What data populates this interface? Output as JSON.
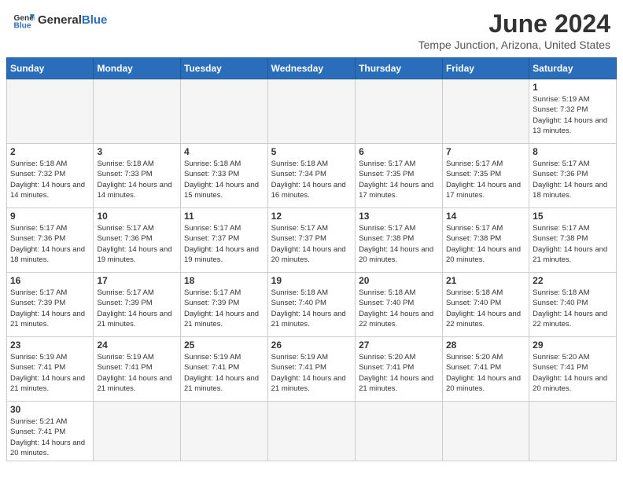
{
  "header": {
    "logo_general": "General",
    "logo_blue": "Blue",
    "month_title": "June 2024",
    "location": "Tempe Junction, Arizona, United States"
  },
  "days_of_week": [
    "Sunday",
    "Monday",
    "Tuesday",
    "Wednesday",
    "Thursday",
    "Friday",
    "Saturday"
  ],
  "weeks": [
    [
      {
        "day": "",
        "empty": true
      },
      {
        "day": "",
        "empty": true
      },
      {
        "day": "",
        "empty": true
      },
      {
        "day": "",
        "empty": true
      },
      {
        "day": "",
        "empty": true
      },
      {
        "day": "",
        "empty": true
      },
      {
        "day": "1",
        "sunrise": "5:19 AM",
        "sunset": "7:32 PM",
        "daylight": "14 hours and 13 minutes."
      }
    ],
    [
      {
        "day": "2",
        "sunrise": "5:18 AM",
        "sunset": "7:32 PM",
        "daylight": "14 hours and 14 minutes."
      },
      {
        "day": "3",
        "sunrise": "5:18 AM",
        "sunset": "7:33 PM",
        "daylight": "14 hours and 14 minutes."
      },
      {
        "day": "4",
        "sunrise": "5:18 AM",
        "sunset": "7:33 PM",
        "daylight": "14 hours and 15 minutes."
      },
      {
        "day": "5",
        "sunrise": "5:18 AM",
        "sunset": "7:34 PM",
        "daylight": "14 hours and 16 minutes."
      },
      {
        "day": "6",
        "sunrise": "5:17 AM",
        "sunset": "7:35 PM",
        "daylight": "14 hours and 17 minutes."
      },
      {
        "day": "7",
        "sunrise": "5:17 AM",
        "sunset": "7:35 PM",
        "daylight": "14 hours and 17 minutes."
      },
      {
        "day": "8",
        "sunrise": "5:17 AM",
        "sunset": "7:36 PM",
        "daylight": "14 hours and 18 minutes."
      }
    ],
    [
      {
        "day": "9",
        "sunrise": "5:17 AM",
        "sunset": "7:36 PM",
        "daylight": "14 hours and 18 minutes."
      },
      {
        "day": "10",
        "sunrise": "5:17 AM",
        "sunset": "7:36 PM",
        "daylight": "14 hours and 19 minutes."
      },
      {
        "day": "11",
        "sunrise": "5:17 AM",
        "sunset": "7:37 PM",
        "daylight": "14 hours and 19 minutes."
      },
      {
        "day": "12",
        "sunrise": "5:17 AM",
        "sunset": "7:37 PM",
        "daylight": "14 hours and 20 minutes."
      },
      {
        "day": "13",
        "sunrise": "5:17 AM",
        "sunset": "7:38 PM",
        "daylight": "14 hours and 20 minutes."
      },
      {
        "day": "14",
        "sunrise": "5:17 AM",
        "sunset": "7:38 PM",
        "daylight": "14 hours and 20 minutes."
      },
      {
        "day": "15",
        "sunrise": "5:17 AM",
        "sunset": "7:38 PM",
        "daylight": "14 hours and 21 minutes."
      }
    ],
    [
      {
        "day": "16",
        "sunrise": "5:17 AM",
        "sunset": "7:39 PM",
        "daylight": "14 hours and 21 minutes."
      },
      {
        "day": "17",
        "sunrise": "5:17 AM",
        "sunset": "7:39 PM",
        "daylight": "14 hours and 21 minutes."
      },
      {
        "day": "18",
        "sunrise": "5:17 AM",
        "sunset": "7:39 PM",
        "daylight": "14 hours and 21 minutes."
      },
      {
        "day": "19",
        "sunrise": "5:18 AM",
        "sunset": "7:40 PM",
        "daylight": "14 hours and 21 minutes."
      },
      {
        "day": "20",
        "sunrise": "5:18 AM",
        "sunset": "7:40 PM",
        "daylight": "14 hours and 22 minutes."
      },
      {
        "day": "21",
        "sunrise": "5:18 AM",
        "sunset": "7:40 PM",
        "daylight": "14 hours and 22 minutes."
      },
      {
        "day": "22",
        "sunrise": "5:18 AM",
        "sunset": "7:40 PM",
        "daylight": "14 hours and 22 minutes."
      }
    ],
    [
      {
        "day": "23",
        "sunrise": "5:19 AM",
        "sunset": "7:41 PM",
        "daylight": "14 hours and 21 minutes."
      },
      {
        "day": "24",
        "sunrise": "5:19 AM",
        "sunset": "7:41 PM",
        "daylight": "14 hours and 21 minutes."
      },
      {
        "day": "25",
        "sunrise": "5:19 AM",
        "sunset": "7:41 PM",
        "daylight": "14 hours and 21 minutes."
      },
      {
        "day": "26",
        "sunrise": "5:19 AM",
        "sunset": "7:41 PM",
        "daylight": "14 hours and 21 minutes."
      },
      {
        "day": "27",
        "sunrise": "5:20 AM",
        "sunset": "7:41 PM",
        "daylight": "14 hours and 21 minutes."
      },
      {
        "day": "28",
        "sunrise": "5:20 AM",
        "sunset": "7:41 PM",
        "daylight": "14 hours and 20 minutes."
      },
      {
        "day": "29",
        "sunrise": "5:20 AM",
        "sunset": "7:41 PM",
        "daylight": "14 hours and 20 minutes."
      }
    ],
    [
      {
        "day": "30",
        "sunrise": "5:21 AM",
        "sunset": "7:41 PM",
        "daylight": "14 hours and 20 minutes."
      },
      {
        "day": "",
        "empty": true
      },
      {
        "day": "",
        "empty": true
      },
      {
        "day": "",
        "empty": true
      },
      {
        "day": "",
        "empty": true
      },
      {
        "day": "",
        "empty": true
      },
      {
        "day": "",
        "empty": true
      }
    ]
  ]
}
